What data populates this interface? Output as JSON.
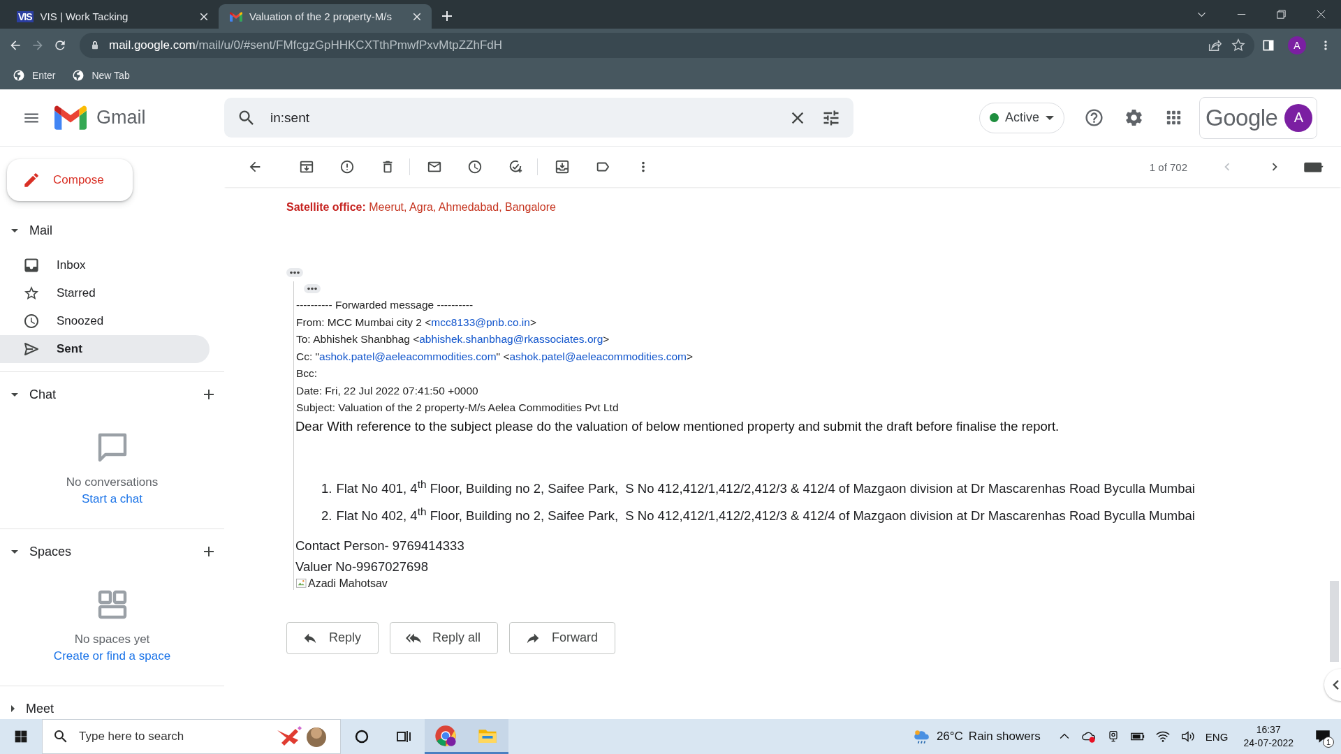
{
  "browser": {
    "tabs": [
      {
        "kind": "vis",
        "favicon_text": "VIS",
        "title": "VIS | Work Tacking",
        "selected": false
      },
      {
        "kind": "gmail",
        "title": "Valuation of the 2 property-M/s",
        "selected": true
      }
    ],
    "url_host": "mail.google.com",
    "url_path": "/mail/u/0/#sent/FMfcgzGpHHKCXTthPmwfPxvMtpZZhFdH",
    "profile_initial": "A",
    "bookmarks": [
      "Enter",
      "New Tab"
    ]
  },
  "gmail": {
    "product": "Gmail",
    "search": {
      "value": "in:sent"
    },
    "status": "Active",
    "brand": "Google",
    "account_initial": "A",
    "compose": "Compose",
    "sidebar": [
      {
        "kind": "mail",
        "label": "Mail",
        "expanded": true,
        "items": [
          {
            "kind": "inbox",
            "label": "Inbox",
            "selected": false
          },
          {
            "kind": "starred",
            "label": "Starred",
            "selected": false
          },
          {
            "kind": "snoozed",
            "label": "Snoozed",
            "selected": false
          },
          {
            "kind": "sent",
            "label": "Sent",
            "selected": true
          }
        ]
      },
      {
        "kind": "chat",
        "label": "Chat",
        "expanded": true,
        "empty_text": "No conversations",
        "link": "Start a chat"
      },
      {
        "kind": "spaces",
        "label": "Spaces",
        "expanded": true,
        "empty_text": "No spaces yet",
        "link": "Create or find a space"
      },
      {
        "kind": "meet",
        "label": "Meet",
        "expanded": false
      }
    ],
    "pagination": "1 of 702",
    "message": {
      "satellite": "**Satellite office:** Meerut, Agra, Ahmedabad, Bangalore",
      "forwarded_header": "---------- Forwarded message ----------",
      "header_lines": [
        [
          {
            "kind": "text",
            "text": "From: MCC Mumbai city 2 <"
          },
          {
            "kind": "link",
            "text": "mcc8133@pnb.co.in"
          },
          {
            "kind": "text",
            "text": ">"
          }
        ],
        [
          {
            "kind": "text",
            "text": "To: Abhishek Shanbhag <"
          },
          {
            "kind": "link",
            "text": "abhishek.shanbhag@rkassociates.org"
          },
          {
            "kind": "text",
            "text": ">"
          }
        ],
        [
          {
            "kind": "text",
            "text": "Cc: \""
          },
          {
            "kind": "link",
            "text": "ashok.patel@aeleacommodities.com"
          },
          {
            "kind": "text",
            "text": "\" <"
          },
          {
            "kind": "link",
            "text": "ashok.patel@aeleacommodities.com"
          },
          {
            "kind": "text",
            "text": ">"
          }
        ],
        [
          {
            "kind": "text",
            "text": "Bcc:"
          }
        ],
        [
          {
            "kind": "text",
            "text": "Date: Fri, 22 Jul 2022 07:41:50 +0000"
          }
        ],
        [
          {
            "kind": "text",
            "text": "Subject: Valuation of the 2 property-M/s Aelea Commodities Pvt Ltd"
          }
        ]
      ],
      "greeting": "Dear With reference to the subject please do the valuation of below mentioned property and submit the draft before finalise the report.",
      "list": [
        {
          "number": "1.",
          "text": "Flat No 401, 4$^{th}$ Floor, Building no 2, Saifee Park,  S No 412,412/1,412/2,412/3 & 412/4 of Mazgaon division at Dr Mascarenhas Road Byculla Mumbai"
        },
        {
          "number": "2.",
          "text": "Flat No 402, 4$^{th}$ Floor, Building no 2, Saifee Park,  S No 412,412/1,412/2,412/3 & 412/4 of Mazgaon division at Dr Mascarenhas Road Byculla Mumbai"
        }
      ],
      "contact": "Contact Person- 9769414333",
      "valuer": "Valuer No-9967027698",
      "image_alt": "Azadi Mahotsav"
    },
    "actions": [
      {
        "kind": "reply",
        "label": "Reply"
      },
      {
        "kind": "reply_all",
        "label": "Reply all"
      },
      {
        "kind": "forward",
        "label": "Forward"
      }
    ]
  },
  "taskbar": {
    "search_placeholder": "Type here to search",
    "temperature": "26°C",
    "weather": "Rain showers",
    "language": "ENG",
    "time": "16:37",
    "date": "24-07-2022",
    "notifications": "1"
  }
}
